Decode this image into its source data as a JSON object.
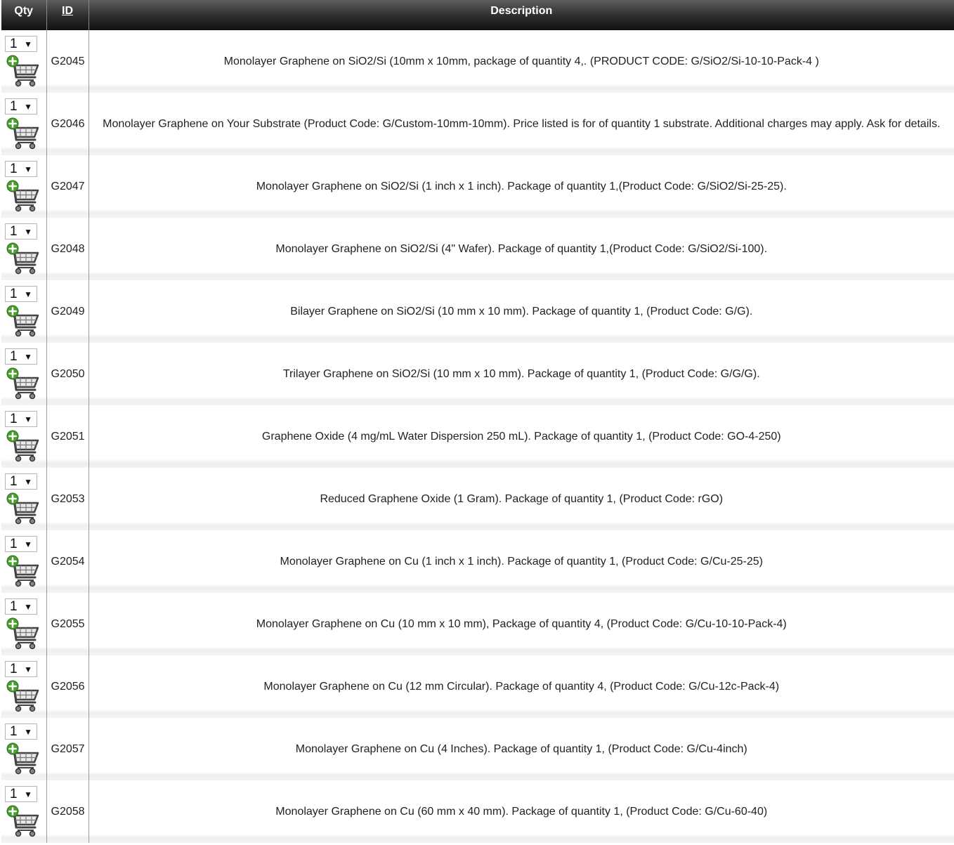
{
  "table": {
    "headers": {
      "qty": "Qty",
      "id": "ID",
      "description": "Description"
    },
    "rows": [
      {
        "qty": "1",
        "id": "G2045",
        "description": "Monolayer Graphene on SiO2/Si (10mm x 10mm, package of quantity 4,. (PRODUCT CODE: G/SiO2/Si-10-10-Pack-4 )"
      },
      {
        "qty": "1",
        "id": "G2046",
        "description": "Monolayer Graphene on Your Substrate (Product Code: G/Custom-10mm-10mm). Price listed is for of quantity 1 substrate. Additional charges may apply. Ask for details."
      },
      {
        "qty": "1",
        "id": "G2047",
        "description": "Monolayer Graphene on SiO2/Si (1 inch x 1 inch). Package of quantity 1,(Product Code: G/SiO2/Si-25-25)."
      },
      {
        "qty": "1",
        "id": "G2048",
        "description": "Monolayer Graphene on SiO2/Si (4\" Wafer). Package of quantity 1,(Product Code: G/SiO2/Si-100)."
      },
      {
        "qty": "1",
        "id": "G2049",
        "description": "Bilayer Graphene on SiO2/Si (10 mm x 10 mm). Package of quantity 1, (Product Code: G/G)."
      },
      {
        "qty": "1",
        "id": "G2050",
        "description": "Trilayer Graphene on SiO2/Si (10 mm x 10 mm). Package of quantity 1, (Product Code: G/G/G)."
      },
      {
        "qty": "1",
        "id": "G2051",
        "description": "Graphene Oxide (4 mg/mL Water Dispersion 250 mL). Package of quantity 1, (Product Code: GO-4-250)"
      },
      {
        "qty": "1",
        "id": "G2053",
        "description": "Reduced Graphene Oxide (1 Gram). Package of quantity 1, (Product Code: rGO)"
      },
      {
        "qty": "1",
        "id": "G2054",
        "description": "Monolayer Graphene on Cu (1 inch x 1 inch). Package of quantity 1, (Product Code: G/Cu-25-25)"
      },
      {
        "qty": "1",
        "id": "G2055",
        "description": "Monolayer Graphene on Cu (10 mm x 10 mm), Package of quantity 4, (Product Code: G/Cu-10-10-Pack-4)"
      },
      {
        "qty": "1",
        "id": "G2056",
        "description": "Monolayer Graphene on Cu (12 mm Circular). Package of quantity 4, (Product Code: G/Cu-12c-Pack-4)"
      },
      {
        "qty": "1",
        "id": "G2057",
        "description": "Monolayer Graphene on Cu (4 Inches). Package of quantity 1, (Product Code: G/Cu-4inch)"
      },
      {
        "qty": "1",
        "id": "G2058",
        "description": "Monolayer Graphene on Cu (60 mm x 40 mm). Package of quantity 1, (Product Code: G/Cu-60-40)"
      }
    ]
  },
  "icons": {
    "qty_dropdown": "chevron-down-icon",
    "cart": "add-to-cart-icon"
  },
  "colors": {
    "header_bg": "#2c2c2c",
    "header_text": "#ffffff",
    "cart_plus": "#4a9e2f"
  }
}
